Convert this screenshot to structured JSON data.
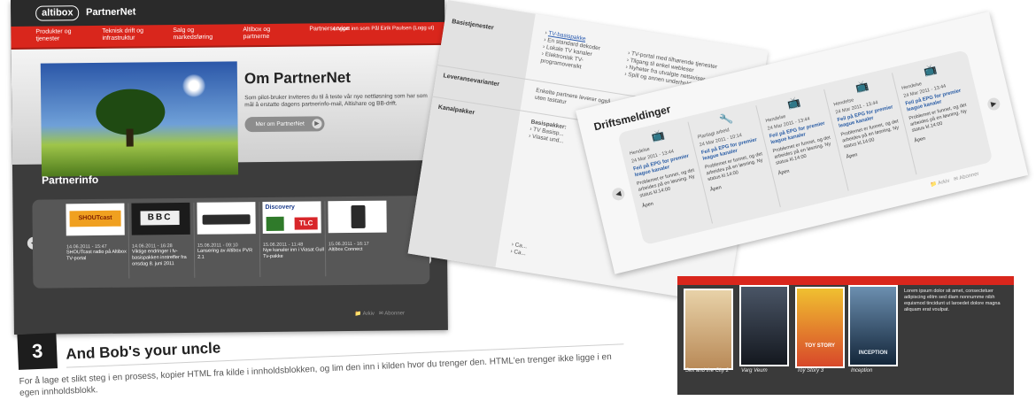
{
  "partnernet": {
    "logo": "altibox",
    "brand": "PartnerNet",
    "login_text": "Logget inn som Pål Eirik Paulsen  (Logg ut)",
    "nav": [
      "Produkter og tjenester",
      "Teknisk drift og infrastruktur",
      "Salg og markedsføring",
      "Altibox og partnerne",
      "Partnerservice"
    ],
    "hero": {
      "title": "Om PartnerNet",
      "text": "Som pilot-bruker inviteres du til å teste vår nye nettløsning som har som mål å erstatte dagens partnerinfo-mail, Altishare og BB-drift.",
      "button": "Mer om PartnerNet"
    },
    "partnerinfo_title": "Partnerinfo",
    "cards": [
      {
        "thumb": "SHOUTcast",
        "date": "14.06.2011 - 15:47",
        "title": "SHOUTcast radio på Altibox TV-portal"
      },
      {
        "thumb": "BBC",
        "date": "14.06.2011 - 16:28",
        "title": "Viktige endringer i fv-basispakken inntreffer fra onsdag 8. juni 2011"
      },
      {
        "thumb": "",
        "date": "15.06.2011 - 09:10",
        "title": "Lansering av Altibox PVR 2.1"
      },
      {
        "thumb": "Discovery",
        "thumb2": "TLC",
        "date": "15.06.2011 - 11:48",
        "title": "Nye kanaler inn i Viasat Gull Tv-pakke"
      },
      {
        "thumb": "",
        "date": "15.06.2011 - 16:17",
        "title": "Altibox Connect"
      }
    ],
    "footer_archive": "Arkiv",
    "footer_subscribe": "Abonner"
  },
  "basis": {
    "labels": [
      "Basistjenester",
      "Leveransevarianter",
      "Kanalpakker"
    ],
    "col1": {
      "link": "TV-basispakke",
      "items": [
        "En standard dekoder",
        "Lokale TV kanaler",
        "Elektronisk TV-programoversikt"
      ]
    },
    "col2": [
      "TV-portal med tilhørende tjenester",
      "Tilgang til enkel webleser",
      "Nyheter fra utvalgte nettaviser",
      "Spill og annen underholdning"
    ],
    "variants": "Enkelte partnere leverer også uten tastatur",
    "packages_head": "Basispakker:",
    "packages": [
      "TV Basisp...",
      "Viasat und..."
    ],
    "extra": [
      "Ca...",
      "Ca..."
    ]
  },
  "drift": {
    "title": "Driftsmeldinger",
    "cards": [
      {
        "icon": "tv",
        "kind": "Hendelse",
        "date": "24 Mar 2011 - 13:44",
        "title": "Feil på EPG for premier league kanaler",
        "body": "Problemet er funnet, og det arbeides på en løsning. Ny status kl.14:00",
        "status": "Åpen"
      },
      {
        "icon": "wrench",
        "kind": "Planlagt arbeid",
        "date": "24 Mar 2011 - 10:14",
        "title": "Feil på EPG for premier league kanaler",
        "body": "Problemet er funnet, og det arbeides på en løsning. Ny status kl.14:00",
        "status": "Åpen"
      },
      {
        "icon": "tv",
        "kind": "Hendelse",
        "date": "24 Mar 2011 - 13:44",
        "title": "Feil på EPG for premier league kanaler",
        "body": "Problemet er funnet, og det arbeides på en løsning. Ny status kl.14:00",
        "status": "Åpen"
      },
      {
        "icon": "tv",
        "kind": "Hendelse",
        "date": "24 Mar 2011 - 13:44",
        "title": "Feil på EPG for premier league kanaler",
        "body": "Problemet er funnet, og det arbeides på en løsning. Ny status kl.14:00",
        "status": "Åpen"
      },
      {
        "icon": "tv",
        "kind": "Hendelse",
        "date": "24 Mar 2011 - 13:44",
        "title": "Feil på EPG for premier league kanaler",
        "body": "Problemet er funnet, og det arbeides på en løsning. Ny status kl.14:00",
        "status": "Åpen"
      }
    ],
    "footer_archive": "Arkiv",
    "footer_subscribe": "Abonner"
  },
  "movies": {
    "items": [
      {
        "caption": "Sex and the City 2",
        "color": "#c9a77a",
        "tag": ""
      },
      {
        "caption": "Varg Veum",
        "color": "#2e3440",
        "tag": ""
      },
      {
        "caption": "Toy Story 3",
        "color": "#d8482a",
        "tag": "TOY STORY"
      },
      {
        "caption": "Inception",
        "color": "#1d3a56",
        "tag": "INCEPTION"
      }
    ],
    "text": "Lorem ipsum dolor sit amet, consectetuer adipiscing elitm sed diam nonnumme nibh equismod tincidunt ut laroedet dolore magna aliquam erat voulpat."
  },
  "step": {
    "number": "3",
    "title": "And Bob's your uncle",
    "text": "For å lage et slikt steg i en prosess, kopier HTML fra kilde i innholdsblokken, og lim den inn i kilden hvor du trenger den. HTML'en trenger ikke ligge i en egen innholdsblokk."
  }
}
